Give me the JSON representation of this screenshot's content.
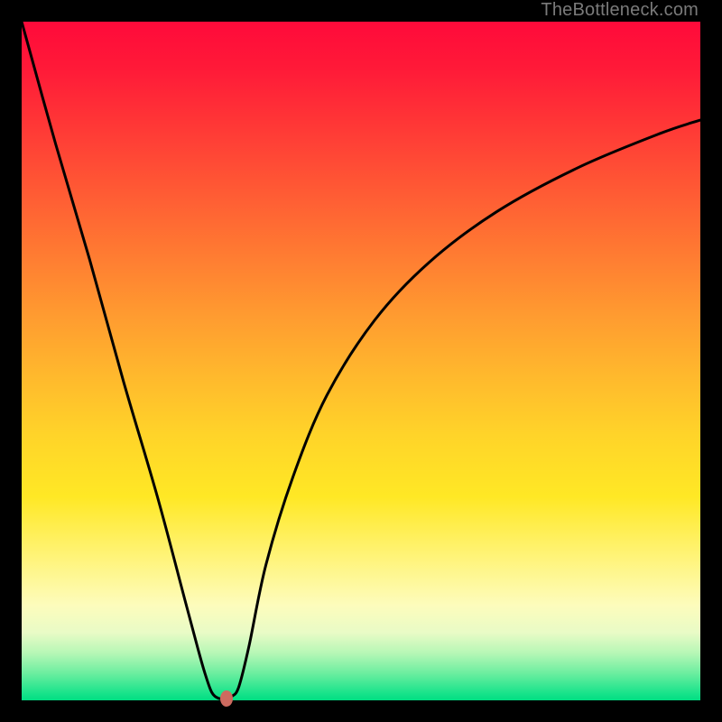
{
  "watermark": "TheBottleneck.com",
  "chart_data": {
    "type": "line",
    "title": "",
    "xlabel": "",
    "ylabel": "",
    "xlim": [
      0,
      100
    ],
    "ylim": [
      0,
      100
    ],
    "series": [
      {
        "name": "bottleneck-curve",
        "x": [
          0,
          5,
          10,
          15,
          20,
          24,
          26,
          27,
          28,
          29,
          30,
          31,
          32,
          33.5,
          36,
          40,
          45,
          52,
          60,
          70,
          82,
          94,
          100
        ],
        "values": [
          100,
          82,
          65,
          47,
          30,
          15,
          7.5,
          4,
          1.2,
          0.3,
          0.3,
          0.6,
          2,
          8,
          20,
          33,
          45,
          56,
          64.5,
          72,
          78.5,
          83.5,
          85.5
        ]
      }
    ],
    "marker": {
      "x": 30.2,
      "y": 0.3
    },
    "gradient_colors": {
      "top": "#ff0a3a",
      "mid_upper": "#ff9a30",
      "mid": "#ffe825",
      "mid_lower": "#fdfcbc",
      "bottom": "#00dd82"
    }
  }
}
